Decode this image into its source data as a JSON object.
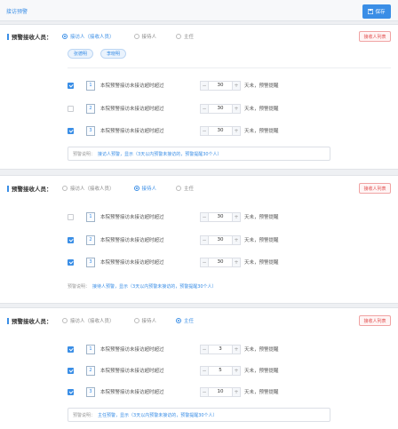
{
  "header": {
    "breadcrumb": "接访预警",
    "save_label": "保存"
  },
  "panels": [
    {
      "label": "预警接收人员：",
      "options": [
        "接访人（接收人员）",
        "接待人",
        "主任"
      ],
      "selected": 0,
      "tag_label": "接收人列表",
      "chips": [
        "张德明",
        "李晓明"
      ],
      "conditions": [
        {
          "checked": true,
          "icon": "1",
          "text": "本院预警接访未接访超时超过",
          "value": "30",
          "unit": "天未，预警提醒"
        },
        {
          "checked": false,
          "icon": "2",
          "text": "本院预警接访未接访超时超过",
          "value": "30",
          "unit": "天未，预警提醒"
        },
        {
          "checked": true,
          "icon": "3",
          "text": "本院预警接访未接访超时超过",
          "value": "30",
          "unit": "天未，预警提醒"
        }
      ],
      "note_label": "预警说明：",
      "note": "接访人预警，显示（3天以内预警未接访的，预警提醒30个人）"
    },
    {
      "label": "预警接收人员：",
      "options": [
        "接访人（接收人员）",
        "接待人",
        "主任"
      ],
      "selected": 1,
      "tag_label": "接收人列表",
      "conditions": [
        {
          "checked": false,
          "icon": "1",
          "text": "本院预警接访未接访超时超过",
          "value": "30",
          "unit": "天未，预警提醒"
        },
        {
          "checked": true,
          "icon": "2",
          "text": "本院预警接访未接访超时超过",
          "value": "30",
          "unit": "天未，预警提醒"
        },
        {
          "checked": true,
          "icon": "3",
          "text": "本院预警接访未接访超时超过",
          "value": "30",
          "unit": "天未，预警提醒"
        }
      ],
      "note_label": "预警说明：",
      "note": "接待人预警，显示（3天以内预警未接访的，预警提醒30个人）"
    },
    {
      "label": "预警接收人员：",
      "options": [
        "接访人（接收人员）",
        "接待人",
        "主任"
      ],
      "selected": 2,
      "tag_label": "接收人列表",
      "conditions": [
        {
          "checked": true,
          "icon": "1",
          "text": "本院预警接访未接访超时超过",
          "value": "3",
          "unit": "天未，预警提醒"
        },
        {
          "checked": true,
          "icon": "2",
          "text": "本院预警接访未接访超时超过",
          "value": "5",
          "unit": "天未，预警提醒"
        },
        {
          "checked": true,
          "icon": "3",
          "text": "本院预警接访未接访超时超过",
          "value": "10",
          "unit": "天未，预警提醒"
        }
      ],
      "note_label": "预警说明：",
      "note": "主任预警，显示（3天以内预警未接访的，预警提醒30个人）"
    }
  ],
  "colors": {
    "accent": "#3a8ee6",
    "danger": "#e04a4a"
  }
}
